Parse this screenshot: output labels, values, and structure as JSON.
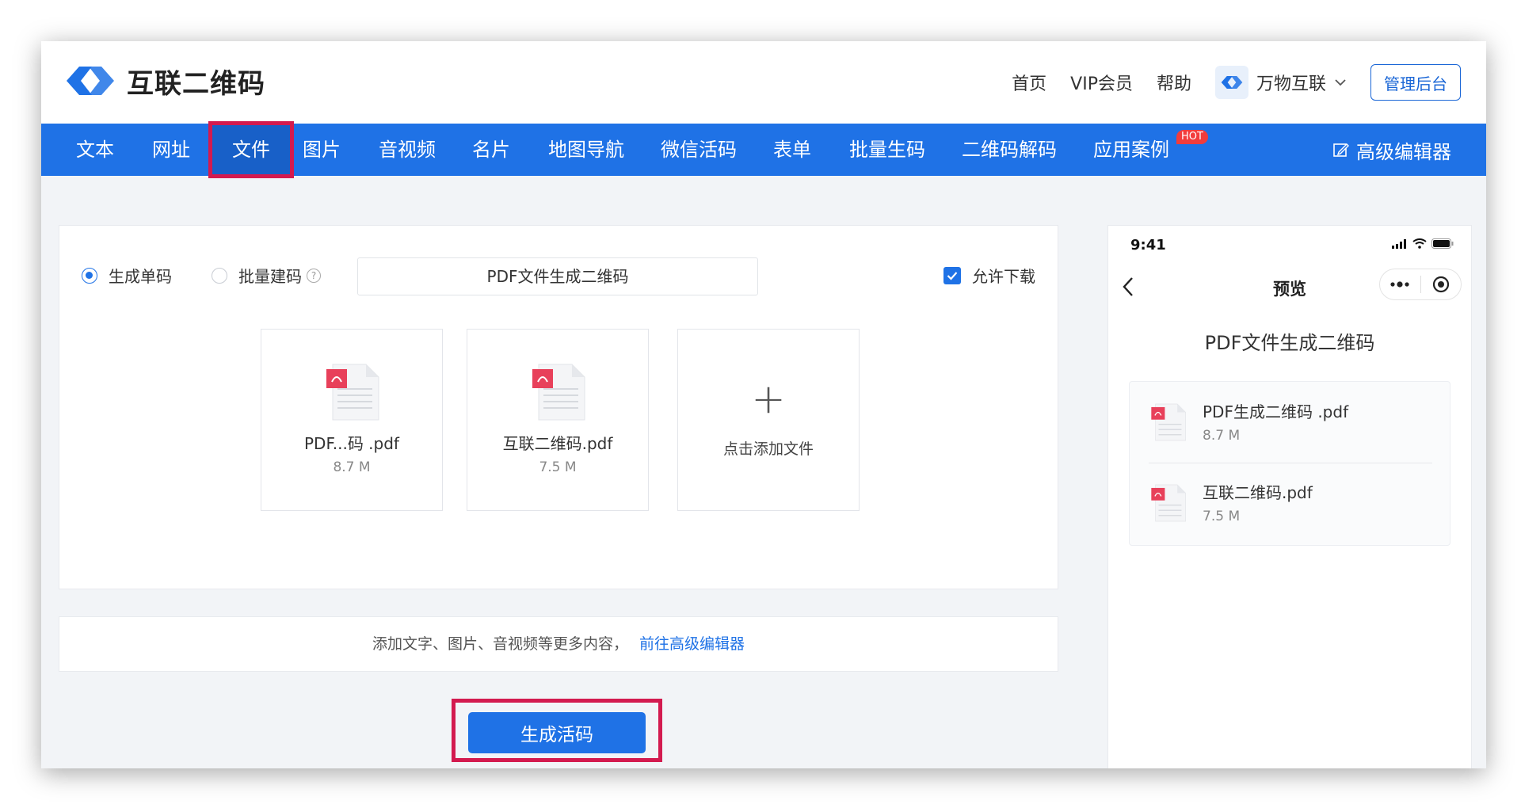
{
  "brand": {
    "name": "互联二维码"
  },
  "top_nav": {
    "links": [
      "首页",
      "VIP会员",
      "帮助"
    ],
    "account": "万物互联",
    "admin_button": "管理后台"
  },
  "nav": {
    "items": [
      "文本",
      "网址",
      "文件",
      "图片",
      "音视频",
      "名片",
      "地图导航",
      "微信活码",
      "表单",
      "批量生码",
      "二维码解码",
      "应用案例"
    ],
    "active": "文件",
    "hot_badge": "HOT",
    "editor_link": "高级编辑器"
  },
  "form": {
    "mode_single": "生成单码",
    "mode_batch": "批量建码",
    "title_value": "PDF文件生成二维码",
    "allow_download": "允许下载",
    "files": [
      {
        "name": "PDF...码 .pdf",
        "size": "8.7 M"
      },
      {
        "name": "互联二维码.pdf",
        "size": "7.5 M"
      }
    ],
    "add_file": "点击添加文件"
  },
  "tip": {
    "text": "添加文字、图片、音视频等更多内容，",
    "link": "前往高级编辑器"
  },
  "generate_button": "生成活码",
  "preview": {
    "time": "9:41",
    "title": "预览",
    "heading": "PDF文件生成二维码",
    "files": [
      {
        "name": "PDF生成二维码 .pdf",
        "size": "8.7 M"
      },
      {
        "name": "互联二维码.pdf",
        "size": "7.5 M"
      }
    ]
  },
  "colors": {
    "accent": "#1f72e6",
    "highlight": "#d31a4f",
    "pdf": "#e8405a"
  }
}
